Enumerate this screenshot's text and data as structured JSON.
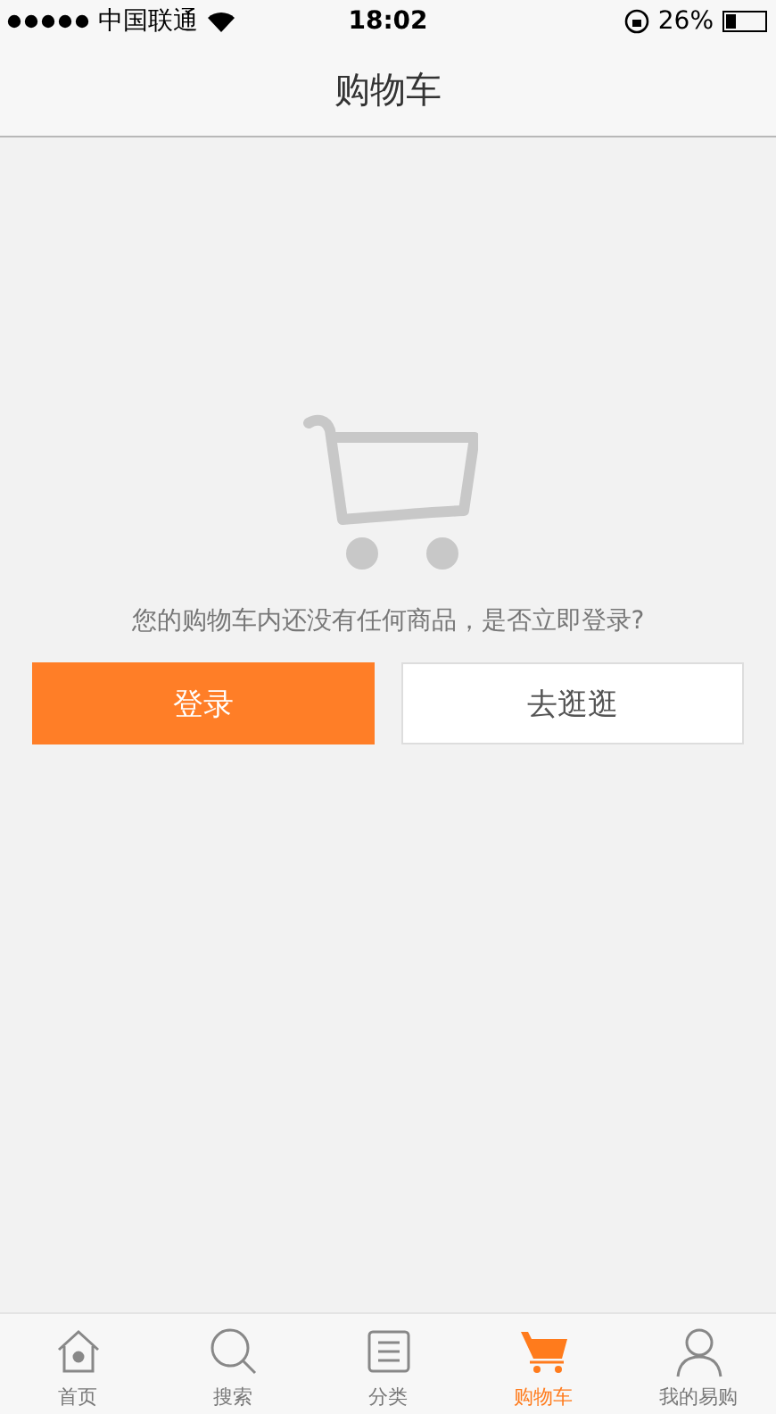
{
  "status_bar": {
    "carrier": "中国联通",
    "time": "18:02",
    "battery": "26%"
  },
  "nav": {
    "title": "购物车"
  },
  "empty": {
    "message": "您的购物车内还没有任何商品，是否立即登录?",
    "buttons": [
      {
        "label": "登录",
        "kind": "primary"
      },
      {
        "label": "去逛逛",
        "kind": "secondary"
      }
    ]
  },
  "tabs": [
    {
      "label": "首页",
      "kind": "home",
      "selected": false
    },
    {
      "label": "搜索",
      "kind": "search",
      "selected": false
    },
    {
      "label": "分类",
      "kind": "list",
      "selected": false
    },
    {
      "label": "购物车",
      "kind": "cart",
      "selected": true
    },
    {
      "label": "我的易购",
      "kind": "user",
      "selected": false
    }
  ]
}
